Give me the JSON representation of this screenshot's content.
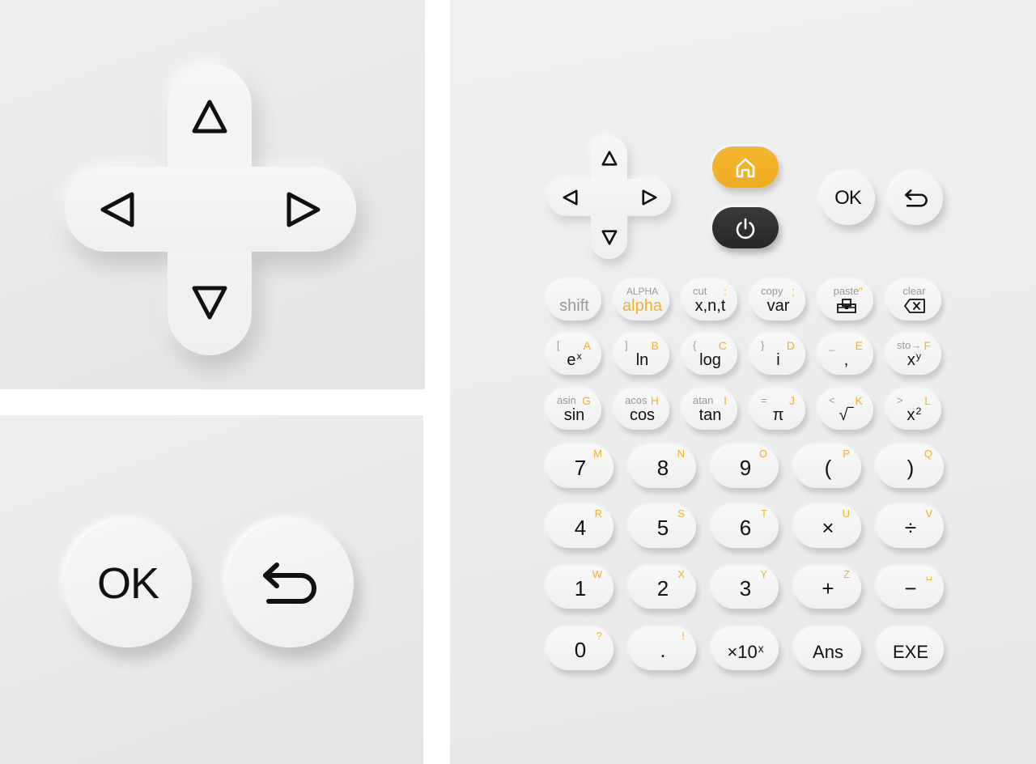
{
  "panels": {
    "dpad_closeup": {
      "buttons": {
        "up": {
          "icon": "triangle-up-icon"
        },
        "down": {
          "icon": "triangle-down-icon"
        },
        "left": {
          "icon": "triangle-left-icon"
        },
        "right": {
          "icon": "triangle-right-icon"
        }
      }
    },
    "okback_closeup": {
      "ok_label": "OK",
      "back_icon": "back-arrow-icon"
    }
  },
  "keyboard": {
    "colors": {
      "accent": "#F0B232",
      "home_key": "#F1B02A",
      "power_key": "#2F2F2F",
      "secondary_text": "#9A9A9A",
      "primary_text": "#111111"
    },
    "top": {
      "home_icon": "home-icon",
      "power_icon": "power-icon",
      "ok_label": "OK",
      "back_icon": "back-arrow-icon"
    },
    "function_rows": [
      [
        {
          "id": "shift",
          "main": "shift",
          "sec": "",
          "alpha": ""
        },
        {
          "id": "alpha",
          "main": "alpha",
          "sec": "ALPHA",
          "alpha": ""
        },
        {
          "id": "xnt",
          "main": "x,n,t",
          "sec": "cut",
          "alpha": ":"
        },
        {
          "id": "var",
          "main": "var",
          "sec": "copy",
          "alpha": ";"
        },
        {
          "id": "toolbox",
          "main": "",
          "sec": "paste",
          "alpha": "\"",
          "icon": "toolbox-icon"
        },
        {
          "id": "backspace",
          "main": "",
          "sec": "clear",
          "alpha": "",
          "icon": "backspace-icon"
        }
      ],
      [
        {
          "id": "exp",
          "main": "e",
          "sup": "x",
          "sec": "[",
          "alpha": "A"
        },
        {
          "id": "ln",
          "main": "ln",
          "sec": "]",
          "alpha": "B"
        },
        {
          "id": "log",
          "main": "log",
          "sec": "{",
          "alpha": "C"
        },
        {
          "id": "imaginary",
          "main": "i",
          "sec": "}",
          "alpha": "D"
        },
        {
          "id": "comma",
          "main": ",",
          "sec": "_",
          "alpha": "E"
        },
        {
          "id": "power",
          "main": "x",
          "sup": "y",
          "sec": "sto→",
          "alpha": "F"
        }
      ],
      [
        {
          "id": "sin",
          "main": "sin",
          "sec": "asin",
          "alpha": "G"
        },
        {
          "id": "cos",
          "main": "cos",
          "sec": "acos",
          "alpha": "H"
        },
        {
          "id": "tan",
          "main": "tan",
          "sec": "atan",
          "alpha": "I"
        },
        {
          "id": "pi",
          "main": "π",
          "sec": "=",
          "alpha": "J"
        },
        {
          "id": "sqrt",
          "main": "√‾",
          "sec": "<",
          "alpha": "K"
        },
        {
          "id": "square",
          "main": "x",
          "sup": "2",
          "sec": ">",
          "alpha": "L"
        }
      ]
    ],
    "number_rows": [
      [
        {
          "id": "7",
          "main": "7",
          "alpha": "M"
        },
        {
          "id": "8",
          "main": "8",
          "alpha": "N"
        },
        {
          "id": "9",
          "main": "9",
          "alpha": "O"
        },
        {
          "id": "lparen",
          "main": "(",
          "alpha": "P"
        },
        {
          "id": "rparen",
          "main": ")",
          "alpha": "Q"
        }
      ],
      [
        {
          "id": "4",
          "main": "4",
          "alpha": "R"
        },
        {
          "id": "5",
          "main": "5",
          "alpha": "S"
        },
        {
          "id": "6",
          "main": "6",
          "alpha": "T"
        },
        {
          "id": "multiply",
          "main": "×",
          "alpha": "U"
        },
        {
          "id": "divide",
          "main": "÷",
          "alpha": "V"
        }
      ],
      [
        {
          "id": "1",
          "main": "1",
          "alpha": "W"
        },
        {
          "id": "2",
          "main": "2",
          "alpha": "X"
        },
        {
          "id": "3",
          "main": "3",
          "alpha": "Y"
        },
        {
          "id": "plus",
          "main": "+",
          "alpha": "Z"
        },
        {
          "id": "minus",
          "main": "−",
          "alpha": "␣"
        }
      ],
      [
        {
          "id": "0",
          "main": "0",
          "alpha": "?"
        },
        {
          "id": "dot",
          "main": ".",
          "alpha": "!"
        },
        {
          "id": "ee",
          "main": "×10",
          "sup": "x",
          "alpha": ""
        },
        {
          "id": "ans",
          "main": "Ans",
          "alpha": ""
        },
        {
          "id": "exe",
          "main": "EXE",
          "alpha": ""
        }
      ]
    ]
  }
}
